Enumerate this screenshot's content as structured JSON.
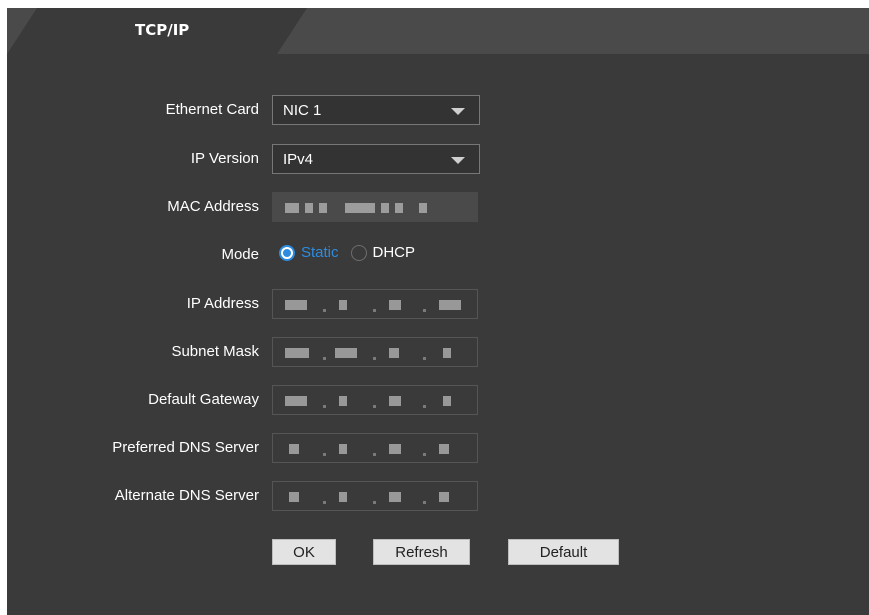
{
  "tab": {
    "label": "TCP/IP"
  },
  "form": {
    "ethernet_card": {
      "label": "Ethernet Card",
      "value": "NIC 1"
    },
    "ip_version": {
      "label": "IP Version",
      "value": "IPv4"
    },
    "mac_address": {
      "label": "MAC Address"
    },
    "mode": {
      "label": "Mode",
      "options": [
        "Static",
        "DHCP"
      ],
      "selected": "Static"
    },
    "ip_address": {
      "label": "IP Address"
    },
    "subnet_mask": {
      "label": "Subnet Mask"
    },
    "default_gateway": {
      "label": "Default Gateway"
    },
    "preferred_dns": {
      "label": "Preferred DNS Server"
    },
    "alternate_dns": {
      "label": "Alternate DNS Server"
    }
  },
  "buttons": {
    "ok": "OK",
    "refresh": "Refresh",
    "default": "Default"
  },
  "colors": {
    "panel_bg": "#3a3a3a",
    "accent": "#2d8be0",
    "text": "#ffffff"
  }
}
